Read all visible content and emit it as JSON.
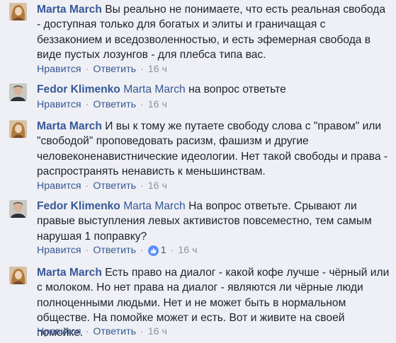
{
  "comments": [
    {
      "author": "Marta March",
      "mention": "",
      "text": "Вы реально не понимаете, что есть реальная свобода - доступная только для богатых и элиты и граничащая с беззаконием и вседозволенностью, и есть эфемерная свобода в виде пустых лозунгов - для плебса типа вас.",
      "like_label": "Нравится",
      "reply_label": "Ответить",
      "reactions": "",
      "time": "16 ч"
    },
    {
      "author": "Fedor Klimenko",
      "mention": "Marta March",
      "text": "на вопрос ответьте",
      "like_label": "Нравится",
      "reply_label": "Ответить",
      "reactions": "",
      "time": "16 ч"
    },
    {
      "author": "Marta March",
      "mention": "",
      "text": "И вы к тому же путаете свободу слова с \"правом\" или \"свободой\" проповедовать расизм, фашизм и другие человеконенавистнические идеологии. Нет такой свободы и права - распространять ненависть к меньшинствам.",
      "like_label": "Нравится",
      "reply_label": "Ответить",
      "reactions": "",
      "time": "16 ч"
    },
    {
      "author": "Fedor Klimenko",
      "mention": "Marta March",
      "text": "На вопрос ответьте. Срывают ли правые выступления левых активистов повсеместно, тем самым нарушая 1 поправку?",
      "like_label": "Нравится",
      "reply_label": "Ответить",
      "reactions": "1",
      "time": "16 ч"
    },
    {
      "author": "Marta March",
      "mention": "",
      "text": "Есть право на диалог - какой кофе лучше - чёрный или с молоком. Но нет права на диалог - являются ли чёрные люди полноценными людьми. Нет и не может быть в нормальном обществе. На помойке может и есть. Вот и живите на своей помойке.",
      "like_label": "Нравится",
      "reply_label": "Ответить",
      "reactions": "",
      "time": "16 ч"
    }
  ],
  "colors": {
    "background": "#eef0f5",
    "link": "#365899",
    "meta": "#90949c",
    "like_icon": "#5890ff"
  },
  "icons": {
    "reaction": "thumbs-up-icon",
    "avatar_marta": "marta-avatar",
    "avatar_fedor": "fedor-avatar"
  }
}
